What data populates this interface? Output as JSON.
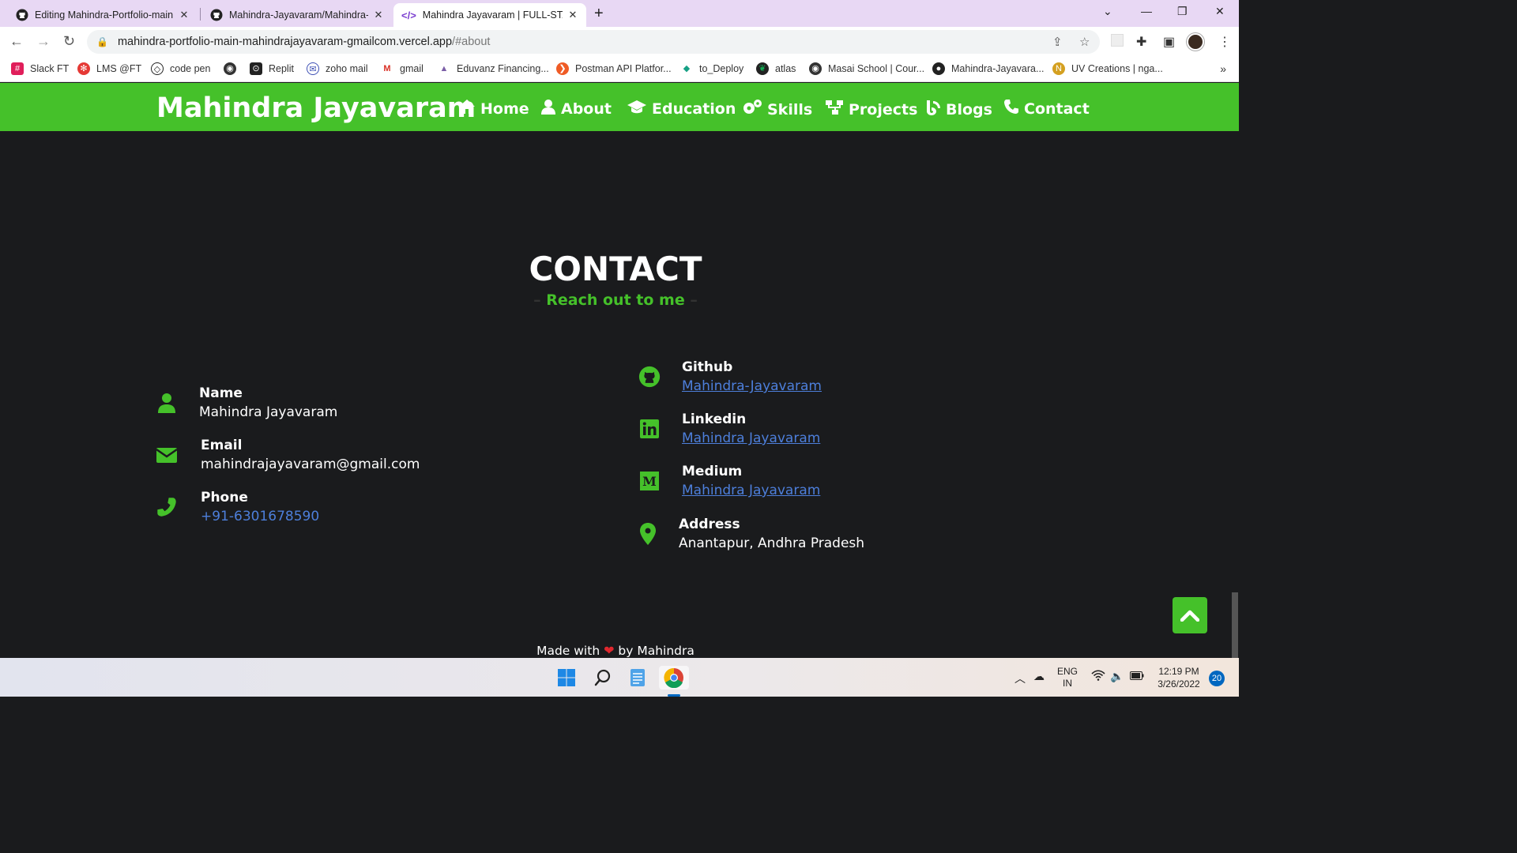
{
  "browser": {
    "tabs": [
      {
        "title": "Editing Mahindra-Portfolio-main",
        "icon": "github-icon"
      },
      {
        "title": "Mahindra-Jayavaram/Mahindra-P",
        "icon": "github-icon"
      },
      {
        "title": "Mahindra Jayavaram | FULL-STAC",
        "icon": "code-icon"
      }
    ],
    "url_host": "mahindra-portfolio-main-mahindrajayavaram-gmailcom.vercel.app",
    "url_path": "/#about",
    "bookmarks": [
      {
        "label": "Slack FT",
        "color": "#e01e5a"
      },
      {
        "label": "LMS @FT",
        "color": "#e53935"
      },
      {
        "label": "code pen",
        "color": "#222222"
      },
      {
        "label": "",
        "color": "#333333"
      },
      {
        "label": "Replit",
        "color": "#222222"
      },
      {
        "label": "zoho mail",
        "color": "#3f51b5"
      },
      {
        "label": "gmail",
        "color": "#d93025"
      },
      {
        "label": "Eduvanz Financing...",
        "color": "#7b5ea7"
      },
      {
        "label": "Postman API Platfor...",
        "color": "#ef5b25"
      },
      {
        "label": "to_Deploy",
        "color": "#16a085"
      },
      {
        "label": "atlas",
        "color": "#13aa52"
      },
      {
        "label": "Masai School | Cour...",
        "color": "#333333"
      },
      {
        "label": "Mahindra-Jayavara...",
        "color": "#222222"
      },
      {
        "label": "UV Creations | nga...",
        "color": "#d4a020"
      }
    ]
  },
  "header": {
    "brand": "Mahindra Jayavaram",
    "menu": [
      {
        "label": "Home",
        "icon": "home-icon"
      },
      {
        "label": "About",
        "icon": "user-icon"
      },
      {
        "label": "Education",
        "icon": "graduation-cap-icon"
      },
      {
        "label": "Skills",
        "icon": "gears-icon"
      },
      {
        "label": "Projects",
        "icon": "sitemap-icon"
      },
      {
        "label": "Blogs",
        "icon": "blog-icon"
      },
      {
        "label": "Contact",
        "icon": "phone-icon"
      }
    ]
  },
  "contact": {
    "title": "CONTACT",
    "subtitle": "Reach out to me",
    "left": [
      {
        "label": "Name",
        "value": "Mahindra Jayavaram",
        "icon": "user-icon"
      },
      {
        "label": "Email",
        "value": "mahindrajayavaram@gmail.com",
        "icon": "envelope-icon"
      },
      {
        "label": "Phone",
        "value": "+91-6301678590",
        "icon": "phone-icon"
      }
    ],
    "right": [
      {
        "label": "Github",
        "value": "Mahindra-Jayavaram",
        "icon": "github-icon"
      },
      {
        "label": "Linkedin",
        "value": "Mahindra Jayavaram",
        "icon": "linkedin-icon"
      },
      {
        "label": "Medium",
        "value": "Mahindra Jayavaram",
        "icon": "medium-icon"
      },
      {
        "label": "Address",
        "value": "Anantapur, Andhra Pradesh",
        "icon": "location-pin-icon"
      }
    ]
  },
  "footer": {
    "made_with": "Made with",
    "by": "by Mahindra"
  },
  "taskbar": {
    "lang_top": "ENG",
    "lang_bottom": "IN",
    "time": "12:19 PM",
    "date": "3/26/2022",
    "notifications": "20"
  },
  "colors": {
    "accent": "#45c12a",
    "background": "#1a1b1d",
    "link": "#4d7fdb"
  }
}
